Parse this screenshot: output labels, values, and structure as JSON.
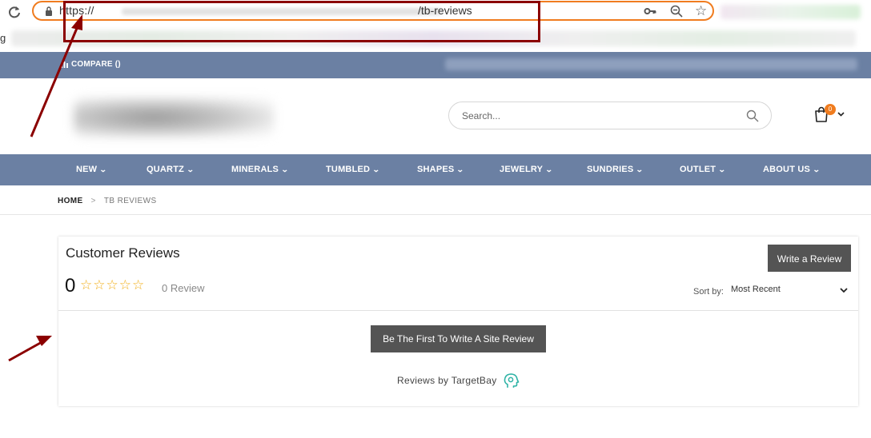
{
  "browser": {
    "url_prefix": "https://",
    "url_path": "/tb-reviews",
    "bookmark_initial": "g"
  },
  "topbar": {
    "compare_label": "COMPARE ()"
  },
  "header": {
    "search_placeholder": "Search...",
    "cart_count": "0"
  },
  "nav": {
    "items": [
      {
        "label": "NEW"
      },
      {
        "label": "QUARTZ"
      },
      {
        "label": "MINERALS"
      },
      {
        "label": "TUMBLED"
      },
      {
        "label": "SHAPES"
      },
      {
        "label": "JEWELRY"
      },
      {
        "label": "SUNDRIES"
      },
      {
        "label": "OUTLET"
      },
      {
        "label": "ABOUT US"
      }
    ]
  },
  "breadcrumb": {
    "home": "HOME",
    "separator": ">",
    "current": "TB REVIEWS"
  },
  "reviews": {
    "title": "Customer Reviews",
    "write_button": "Write a Review",
    "average_rating": "0",
    "stars_display": "☆☆☆☆☆",
    "rating_out_of": 5,
    "review_count": "0 Review",
    "sort_label": "Sort by:",
    "sort_selected": "Most Recent",
    "first_review_button": "Be The First To Write A Site Review",
    "powered_by": "Reviews by TargetBay"
  },
  "colors": {
    "nav_bar": "#6b80a3",
    "accent_orange": "#f07c1f",
    "button_dark": "#545454",
    "star_gold": "#f2b01e",
    "annotation_red": "#8b0000"
  }
}
